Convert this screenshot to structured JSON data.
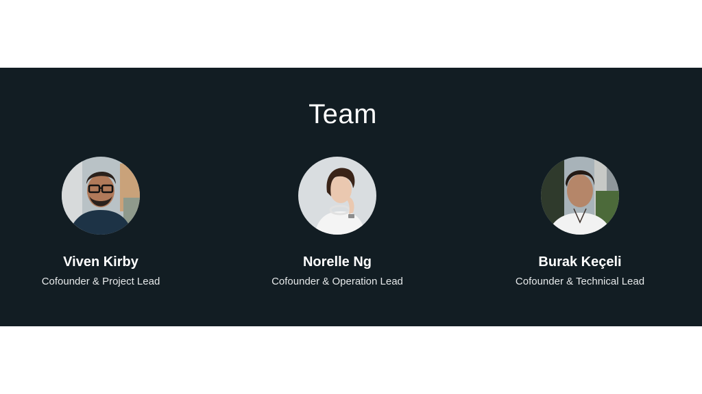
{
  "section": {
    "heading": "Team"
  },
  "members": [
    {
      "name": "Viven Kirby",
      "role": "Cofounder & Project Lead"
    },
    {
      "name": "Norelle Ng",
      "role": "Cofounder & Operation Lead"
    },
    {
      "name": "Burak Keçeli",
      "role": "Cofounder & Technical Lead"
    }
  ],
  "colors": {
    "section_background": "#121d23",
    "page_background": "#ffffff",
    "text_primary": "#ffffff"
  }
}
